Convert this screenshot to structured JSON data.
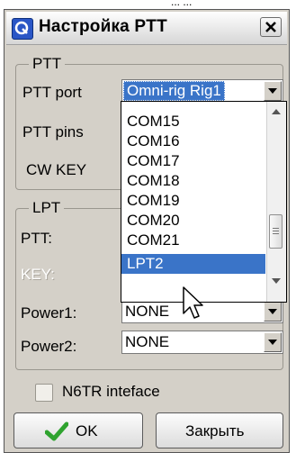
{
  "background_window": {
    "text": "... ..."
  },
  "window": {
    "title": "Настройка PTT",
    "icon": "app-logo-icon",
    "close_icon": "close-icon"
  },
  "ptt_group": {
    "legend": "PTT",
    "port_label": "PTT port",
    "port_value": "Omni-rig Rig1",
    "pins_label": "PTT pins",
    "cw_key_label": "CW KEY"
  },
  "port_dropdown": {
    "items": [
      "COM15",
      "COM16",
      "COM17",
      "COM18",
      "COM19",
      "COM20",
      "COM21",
      "LPT2"
    ],
    "selected": "LPT2"
  },
  "lpt_group": {
    "legend": "LPT",
    "ptt_label": "PTT:",
    "key_label": "KEY:",
    "power1_label": "Power1:",
    "power1_value": "NONE",
    "power2_label": "Power2:",
    "power2_value": "NONE"
  },
  "n6tr_checkbox": {
    "label": "N6TR inteface",
    "checked": false
  },
  "buttons": {
    "ok": "OK",
    "close": "Закрыть"
  },
  "colors": {
    "selection": "#3a74c8",
    "dialog_bg": "#d4d0c8",
    "ok_check": "#2fa32f"
  }
}
